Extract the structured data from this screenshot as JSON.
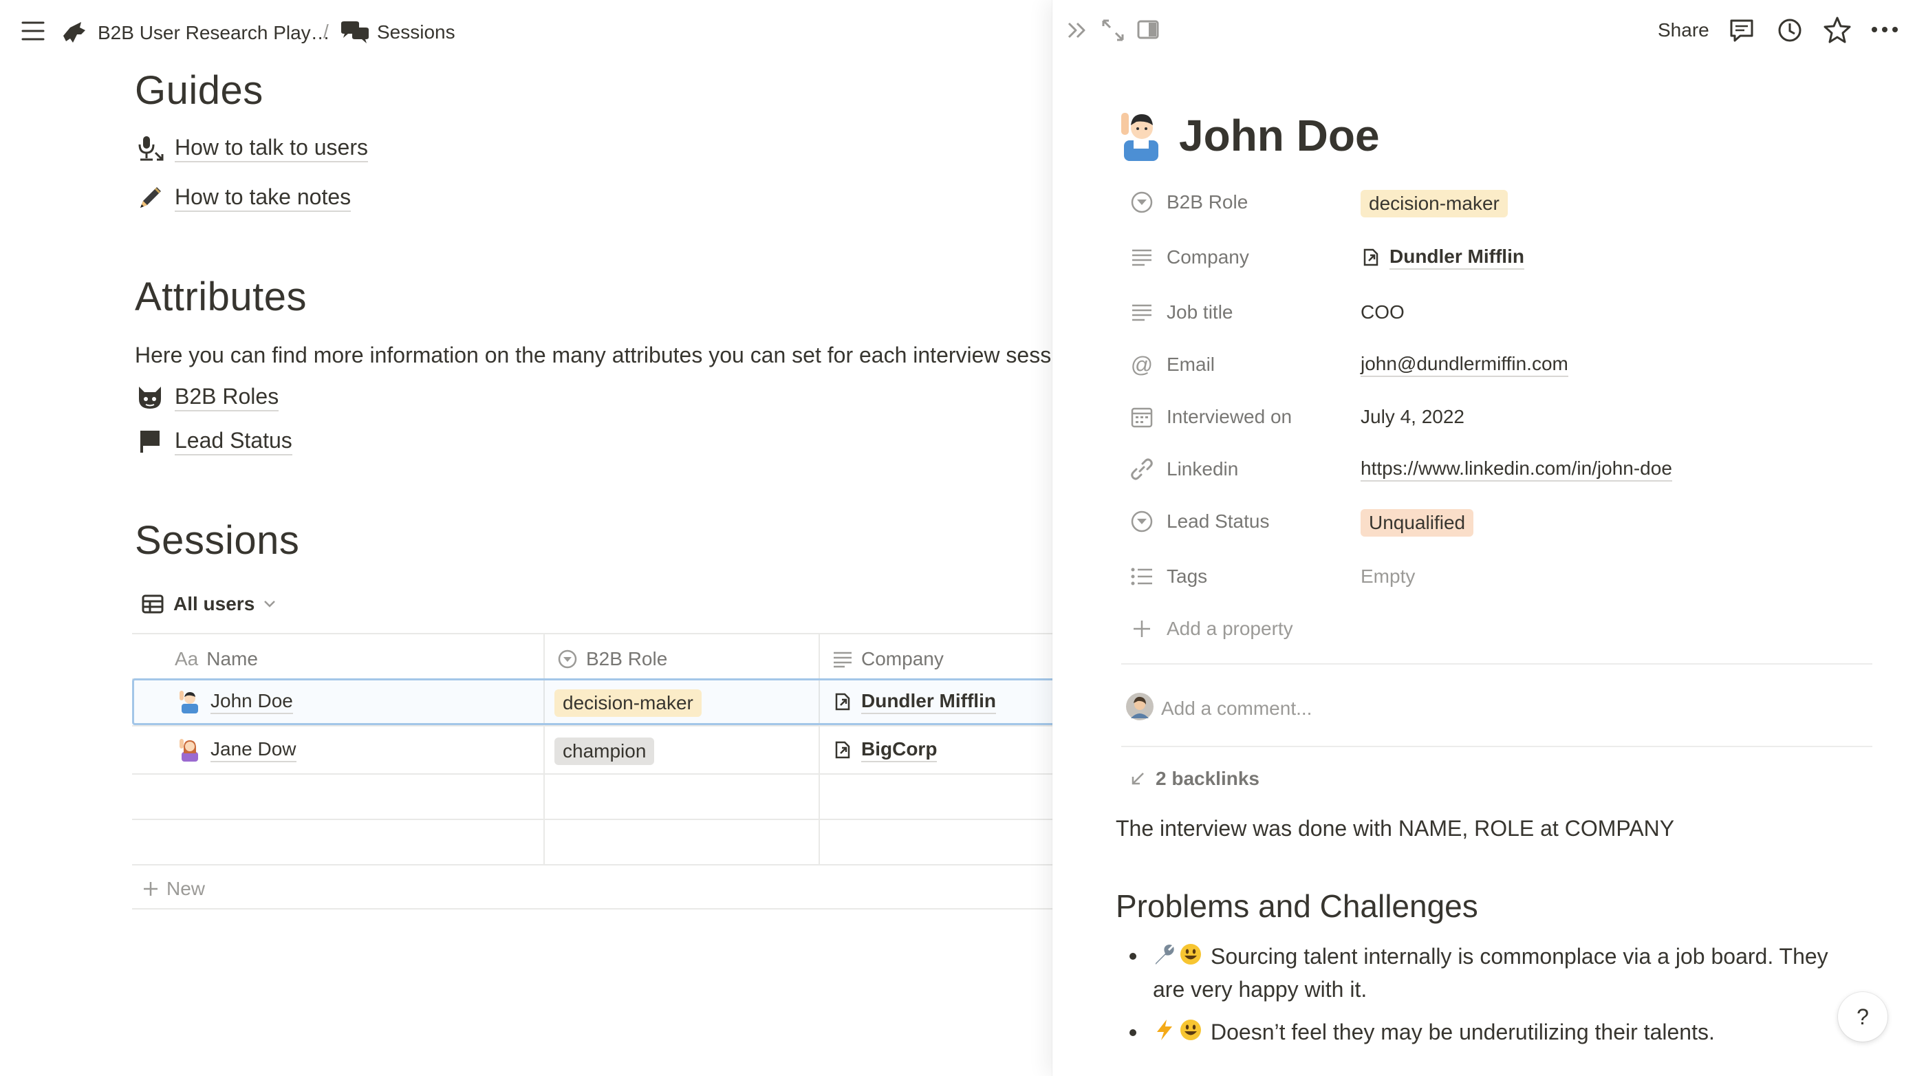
{
  "breadcrumb": {
    "workspace": "B2B User Research Play…",
    "separator": "/",
    "page": "Sessions"
  },
  "guides": {
    "heading": "Guides",
    "links": [
      "How to talk to users",
      "How to take notes"
    ]
  },
  "attributes": {
    "heading": "Attributes",
    "description": "Here you can find more information on the many attributes you can set for each interview sess",
    "links": [
      "B2B Roles",
      "Lead Status"
    ]
  },
  "sessions": {
    "heading": "Sessions",
    "view_label": "All users",
    "columns": {
      "name_prefix": "Aa",
      "name": "Name",
      "role": "B2B Role",
      "company": "Company"
    },
    "rows": [
      {
        "name": "John Doe",
        "role": "decision-maker",
        "company": "Dundler Mifflin"
      },
      {
        "name": "Jane Dow",
        "role": "champion",
        "company": "BigCorp"
      }
    ],
    "new_label": "New"
  },
  "panel": {
    "share_label": "Share",
    "title": "John Doe",
    "properties": [
      {
        "label": "B2B Role",
        "value": "decision-maker"
      },
      {
        "label": "Company",
        "value": "Dundler Mifflin"
      },
      {
        "label": "Job title",
        "value": "COO"
      },
      {
        "label": "Email",
        "value": "john@dundlermiffin.com"
      },
      {
        "label": "Interviewed on",
        "value": "July 4, 2022"
      },
      {
        "label": "Linkedin",
        "value": "https://www.linkedin.com/in/john-doe"
      },
      {
        "label": "Lead Status",
        "value": "Unqualified"
      },
      {
        "label": "Tags",
        "value": "Empty"
      }
    ],
    "add_property": "Add a property",
    "comment_placeholder": "Add a comment...",
    "backlinks": "2 backlinks",
    "intro": "The interview was done with NAME, ROLE at COMPANY",
    "section_heading": "Problems and Challenges",
    "bullets": [
      {
        "line1": "Sourcing talent internally is commonplace via a job board. They",
        "line2": "are very happy with it."
      },
      {
        "line1": "Doesn’t feel they may be underutilizing their talents."
      }
    ],
    "help": "?"
  },
  "colors": {
    "text": "#37352f",
    "muted": "#787774",
    "tag_decision_maker_bg": "#fbecc8",
    "tag_champion_bg": "#e3e2e0",
    "tag_unqualified_bg": "#fadec9",
    "selection": "#a3c6e8"
  }
}
